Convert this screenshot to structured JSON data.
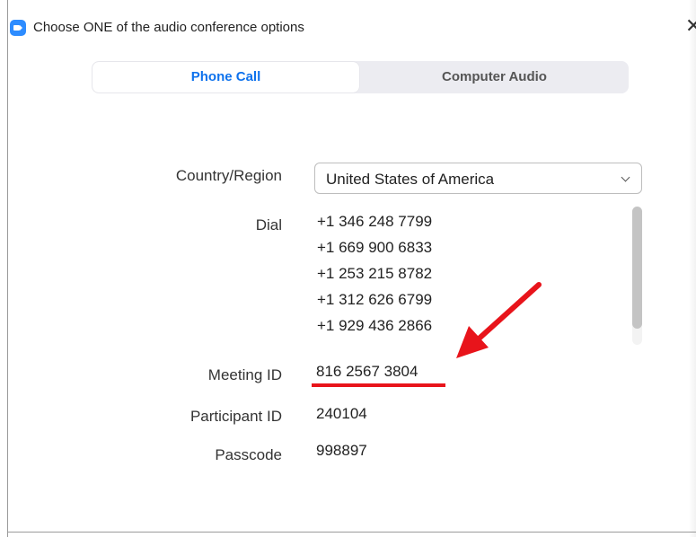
{
  "window": {
    "title": "Choose ONE of the audio conference options",
    "close_glyph": "✕",
    "icon": "zoom-camera-icon"
  },
  "tabs": [
    {
      "label": "Phone Call",
      "selected": true
    },
    {
      "label": "Computer Audio",
      "selected": false
    }
  ],
  "form": {
    "country_label": "Country/Region",
    "country_value": "United States of America",
    "dial_label": "Dial",
    "dial_numbers": [
      "+1 346 248 7799",
      "+1 669 900 6833",
      "+1 253 215 8782",
      "+1 312 626 6799",
      "+1 929 436 2866"
    ],
    "meeting_id_label": "Meeting ID",
    "meeting_id": "816 2567 3804",
    "participant_id_label": "Participant ID",
    "participant_id": "240104",
    "passcode_label": "Passcode",
    "passcode": "998897"
  },
  "annotations": {
    "arrow_color": "#e8141b",
    "underline_color": "#e8141b"
  },
  "colors": {
    "accent": "#0e72ed",
    "tab_background": "#ececf1"
  }
}
